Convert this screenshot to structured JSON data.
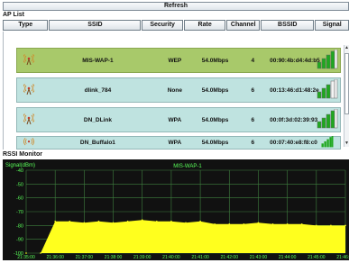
{
  "toolbar": {
    "refresh_label": "Refresh"
  },
  "ap_list": {
    "title": "AP List",
    "columns": [
      "Type",
      "SSID",
      "Security",
      "Rate",
      "Channel",
      "BSSID",
      "Signal"
    ],
    "rows": [
      {
        "ssid": "MIS-WAP-1",
        "security": "WEP",
        "rate": "54.0Mbps",
        "channel": "4",
        "bssid": "00:90:4b:d4:4d:b5",
        "signal_bars": 4,
        "selected": true
      },
      {
        "ssid": "dlink_784",
        "security": "None",
        "rate": "54.0Mbps",
        "channel": "6",
        "bssid": "00:13:46:d1:48:2e",
        "signal_bars": 3,
        "selected": false
      },
      {
        "ssid": "DN_DLink",
        "security": "WPA",
        "rate": "54.0Mbps",
        "channel": "6",
        "bssid": "00:0f:3d:02:39:93",
        "signal_bars": 4,
        "selected": false
      },
      {
        "ssid": "DN_Buffalo1",
        "security": "WPA",
        "rate": "54.0Mbps",
        "channel": "6",
        "bssid": "00:07:40:e8:f8:c0",
        "signal_bars": 5,
        "selected": false
      }
    ]
  },
  "rssi": {
    "title": "RSSI Monitor",
    "graph_title": "MIS-WAP-1",
    "ylabel": "Signal(dBm)",
    "colors": {
      "background": "#111111",
      "grid": "#3f7f3f",
      "fill": "#ffff1e",
      "axis_text": "#59ff59"
    }
  },
  "chart_data": {
    "type": "area",
    "title": "MIS-WAP-1",
    "ylabel": "Signal(dBm)",
    "ylim": [
      -100,
      -40
    ],
    "yticks": [
      -40,
      -50,
      -60,
      -70,
      -80,
      -90,
      -100
    ],
    "xticks": [
      "21:35:00",
      "21:36:00",
      "21:37:00",
      "21:38:00",
      "21:39:00",
      "21:40:00",
      "21:41:00",
      "21:42:00",
      "21:43:00",
      "21:44:00",
      "21:45:00",
      "21:46:00"
    ],
    "x": [
      "21:35:00",
      "21:35:30",
      "21:36:00",
      "21:36:30",
      "21:37:00",
      "21:37:30",
      "21:38:00",
      "21:38:30",
      "21:39:00",
      "21:39:30",
      "21:40:00",
      "21:40:30",
      "21:41:00",
      "21:41:30",
      "21:42:00",
      "21:42:30",
      "21:43:00",
      "21:43:30",
      "21:44:00",
      "21:44:30",
      "21:45:00",
      "21:45:30",
      "21:46:00"
    ],
    "values": [
      -100,
      -100,
      -77,
      -77,
      -78,
      -77,
      -78,
      -77,
      -76,
      -77,
      -77,
      -78,
      -77,
      -79,
      -79,
      -79,
      -78,
      -79,
      -79,
      -79,
      -80,
      -80,
      -80
    ],
    "grid": true
  }
}
